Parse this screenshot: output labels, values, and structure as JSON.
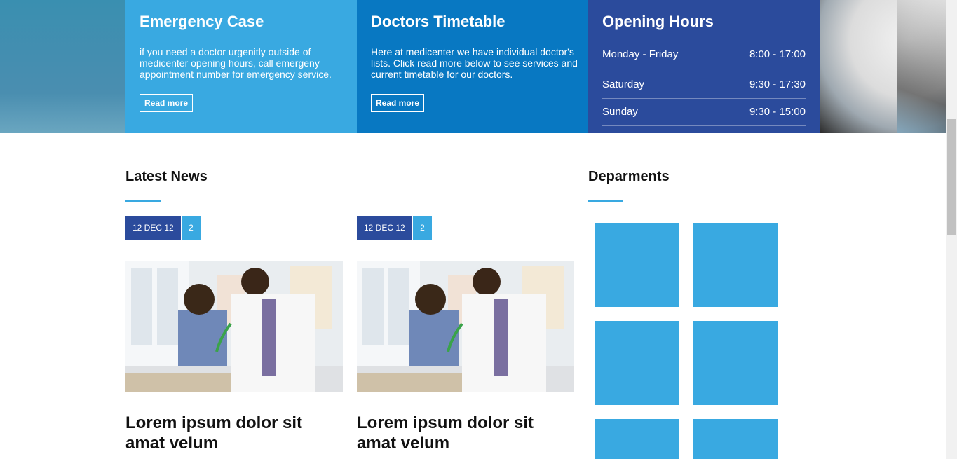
{
  "panels": {
    "emergency": {
      "title": "Emergency Case",
      "text": "if you need a doctor urgenitly outside of medicenter opening hours, call emergeny appointment number for emergency service.",
      "button": "Read more"
    },
    "timetable": {
      "title": "Doctors Timetable",
      "text": "Here at medicenter we have individual doctor's lists. Click read more below to see services and current timetable for our doctors.",
      "button": "Read more"
    },
    "hours": {
      "title": "Opening Hours",
      "rows": [
        {
          "day": "Monday - Friday",
          "time": "8:00 - 17:00"
        },
        {
          "day": "Saturday",
          "time": "9:30 - 17:30"
        },
        {
          "day": "Sunday",
          "time": "9:30 - 15:00"
        }
      ]
    }
  },
  "news": {
    "title": "Latest News",
    "items": [
      {
        "date": "12 DEC 12",
        "comments": "2",
        "title": "Lorem ipsum dolor sit amat velum"
      },
      {
        "date": "12 DEC 12",
        "comments": "2",
        "title": "Lorem ipsum dolor sit amat velum"
      }
    ]
  },
  "departments": {
    "title": "Deparments",
    "tiles": 6
  },
  "colors": {
    "light_blue": "#39a9e1",
    "mid_blue": "#0878c2",
    "navy": "#2b4b9c"
  }
}
